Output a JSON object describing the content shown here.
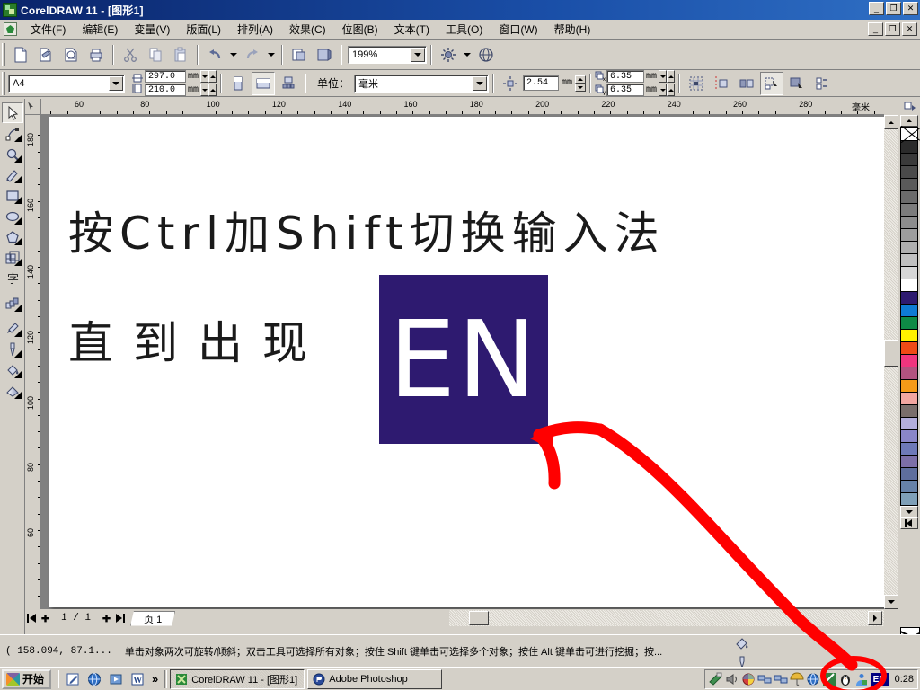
{
  "window": {
    "title": "CorelDRAW 11 - [图形1]",
    "app_icon": "coreldraw-icon",
    "buttons": {
      "minimize": "_",
      "restore": "❐",
      "close": "✕"
    }
  },
  "menubar": {
    "doc_icon": "document-icon",
    "items": [
      {
        "label": "文件(F)"
      },
      {
        "label": "编辑(E)"
      },
      {
        "label": "变量(V)"
      },
      {
        "label": "版面(L)"
      },
      {
        "label": "排列(A)"
      },
      {
        "label": "效果(C)"
      },
      {
        "label": "位图(B)"
      },
      {
        "label": "文本(T)"
      },
      {
        "label": "工具(O)"
      },
      {
        "label": "窗口(W)"
      },
      {
        "label": "帮助(H)"
      }
    ]
  },
  "standard_toolbar": {
    "buttons": [
      {
        "name": "new-icon",
        "glyph": "new"
      },
      {
        "name": "open-icon",
        "glyph": "open"
      },
      {
        "name": "save-icon",
        "glyph": "save"
      },
      {
        "name": "print-icon",
        "glyph": "print"
      },
      {
        "name": "cut-icon",
        "glyph": "cut"
      },
      {
        "name": "copy-icon",
        "glyph": "copy"
      },
      {
        "name": "paste-icon",
        "glyph": "paste"
      },
      {
        "name": "undo-icon",
        "glyph": "undo"
      },
      {
        "name": "redo-icon",
        "glyph": "redo"
      },
      {
        "name": "import-icon",
        "glyph": "import"
      },
      {
        "name": "export-icon",
        "glyph": "export"
      }
    ],
    "zoom_value": "199%",
    "app_launcher_icon": "app-launcher-icon",
    "corel_online_icon": "corel-online-icon"
  },
  "property_bar": {
    "paper_type": "A4",
    "page_width": "297.0",
    "page_height": "210.0",
    "width_unit": "mm",
    "height_unit": "mm",
    "orientation_portrait_icon": "portrait-icon",
    "orientation_landscape_icon": "landscape-icon",
    "page_setup_icon": "page-setup-icon",
    "units_label": "单位：",
    "units_value": "毫米",
    "nudge_value": "2.54",
    "nudge_unit": "mm",
    "duplicate_x_label": "x",
    "duplicate_x": "6.35",
    "duplicate_y_label": "y",
    "duplicate_y": "6.35",
    "duplicate_unit": "mm",
    "snap_grid_icon": "snap-to-grid-icon",
    "snap_guide_icon": "snap-to-guidelines-icon",
    "snap_object_icon": "snap-to-objects-icon",
    "treat_as_filled_icon": "treat-as-filled-icon",
    "dynamic_guides_icon": "dynamic-guides-icon",
    "options_icon": "options-icon"
  },
  "toolbox": {
    "tools": [
      {
        "name": "pick-tool",
        "glyph": "pick",
        "active": true,
        "flyout": false
      },
      {
        "name": "shape-tool",
        "glyph": "shape",
        "active": false,
        "flyout": true
      },
      {
        "name": "zoom-tool",
        "glyph": "zoom",
        "active": false,
        "flyout": true
      },
      {
        "name": "freehand-tool",
        "glyph": "freehand",
        "active": false,
        "flyout": true
      },
      {
        "name": "rectangle-tool",
        "glyph": "rectangle",
        "active": false,
        "flyout": true
      },
      {
        "name": "ellipse-tool",
        "glyph": "ellipse",
        "active": false,
        "flyout": true
      },
      {
        "name": "polygon-tool",
        "glyph": "polygon",
        "active": false,
        "flyout": true
      },
      {
        "name": "graph-paper-tool",
        "glyph": "graphpaper",
        "active": false,
        "flyout": true
      },
      {
        "name": "text-tool",
        "glyph": "text",
        "active": false,
        "flyout": false
      },
      {
        "name": "interactive-blend-tool",
        "glyph": "blend",
        "active": false,
        "flyout": true
      },
      {
        "name": "eyedropper-tool",
        "glyph": "eyedropper",
        "active": false,
        "flyout": true
      },
      {
        "name": "outline-tool",
        "glyph": "outline",
        "active": false,
        "flyout": true
      },
      {
        "name": "fill-tool",
        "glyph": "fill",
        "active": false,
        "flyout": true
      },
      {
        "name": "interactive-fill-tool",
        "glyph": "interactivefill",
        "active": false,
        "flyout": true
      }
    ]
  },
  "rulers": {
    "unit_label": "毫米",
    "horizontal_ticks": [
      "60",
      "80",
      "100",
      "120",
      "140",
      "160",
      "180",
      "200",
      "220",
      "240",
      "260",
      "280"
    ],
    "vertical_ticks": [
      "180",
      "160",
      "140",
      "120",
      "100",
      "80",
      "60"
    ]
  },
  "canvas": {
    "line1": "按Ctrl加Shift切换输入法",
    "line2": "直到出现",
    "en_badge_text": "EN",
    "en_badge_color": "#2E1A70",
    "text_color": "#1A1A1A",
    "page_background": "#FFFFFF"
  },
  "annotations": {
    "arrow_color": "#FF0000",
    "ellipse_color": "#FF0000",
    "arrow_name": "red-arrow-annotation",
    "ellipse_name": "red-ellipse-annotation"
  },
  "page_navigator": {
    "first_icon": "first-page-icon",
    "prev_add_icon": "add-page-before-icon",
    "page_indicator": "1 / 1",
    "next_add_icon": "add-page-after-icon",
    "last_icon": "last-page-icon",
    "tab_label": "页 1"
  },
  "status_bar": {
    "coordinates": "( 158.094, 87.1...",
    "hint": "单击对象两次可旋转/倾斜；双击工具可选择所有对象；按住 Shift 键单击可选择多个对象；按住 Alt 键单击可进行挖掘；按...",
    "fill_icon": "fill-swatch-icon",
    "outline_icon": "outline-swatch-icon"
  },
  "palette": {
    "scroll_up_icon": "palette-scroll-up-icon",
    "scroll_down_icon": "palette-scroll-down-icon",
    "scroll_home_icon": "palette-scroll-home-icon",
    "no_color_label": "no-color",
    "colors": [
      "#2B2B2B",
      "#3A3A3A",
      "#4A4A4A",
      "#5A5A5A",
      "#6B6B6B",
      "#7C7C7C",
      "#8D8D8D",
      "#9E9E9E",
      "#AFAFAF",
      "#C0C0C0",
      "#D6D6D6",
      "#FFFFFF",
      "#2E1A70",
      "#0E7BD4",
      "#0E8A46",
      "#FFF200",
      "#F04A16",
      "#F0357E",
      "#B2537F",
      "#F59A18",
      "#F2A6A0",
      "#7A6E6B",
      "#B3AEDC",
      "#8A86C8",
      "#6E79B8",
      "#7C6FA8",
      "#5E6E9E",
      "#6682A8",
      "#7FA0B8"
    ]
  },
  "taskbar": {
    "start_label": "开始",
    "quicklaunch": [
      {
        "name": "quicklaunch-notepad-icon"
      },
      {
        "name": "quicklaunch-internet-icon"
      },
      {
        "name": "quicklaunch-media-icon"
      },
      {
        "name": "quicklaunch-word-icon"
      }
    ],
    "overflow_label": "»",
    "tasks": [
      {
        "label": "CorelDRAW 11 - [图形1]",
        "icon": "coreldraw-task-icon",
        "active": true
      },
      {
        "label": "Adobe Photoshop",
        "icon": "photoshop-task-icon",
        "active": false
      }
    ],
    "tray_icons": [
      {
        "name": "tray-scanner-icon",
        "color": "#2f8f3f"
      },
      {
        "name": "tray-volume-icon",
        "color": "#5a5a5a"
      },
      {
        "name": "tray-display-icon",
        "color": "#d43f3f"
      },
      {
        "name": "tray-network1-icon",
        "color": "#3f5fd4"
      },
      {
        "name": "tray-network2-icon",
        "color": "#3f5fd4"
      },
      {
        "name": "tray-umbrella-icon",
        "color": "#e8b83a"
      },
      {
        "name": "tray-globe-icon",
        "color": "#2f6fc4"
      },
      {
        "name": "tray-pen-icon",
        "color": "#3f8f3f"
      },
      {
        "name": "tray-penguin-icon",
        "color": "#222222"
      },
      {
        "name": "tray-ime-icon",
        "color": "#3f7fd4"
      }
    ],
    "language_indicator": "EN",
    "clock": "0:28"
  }
}
